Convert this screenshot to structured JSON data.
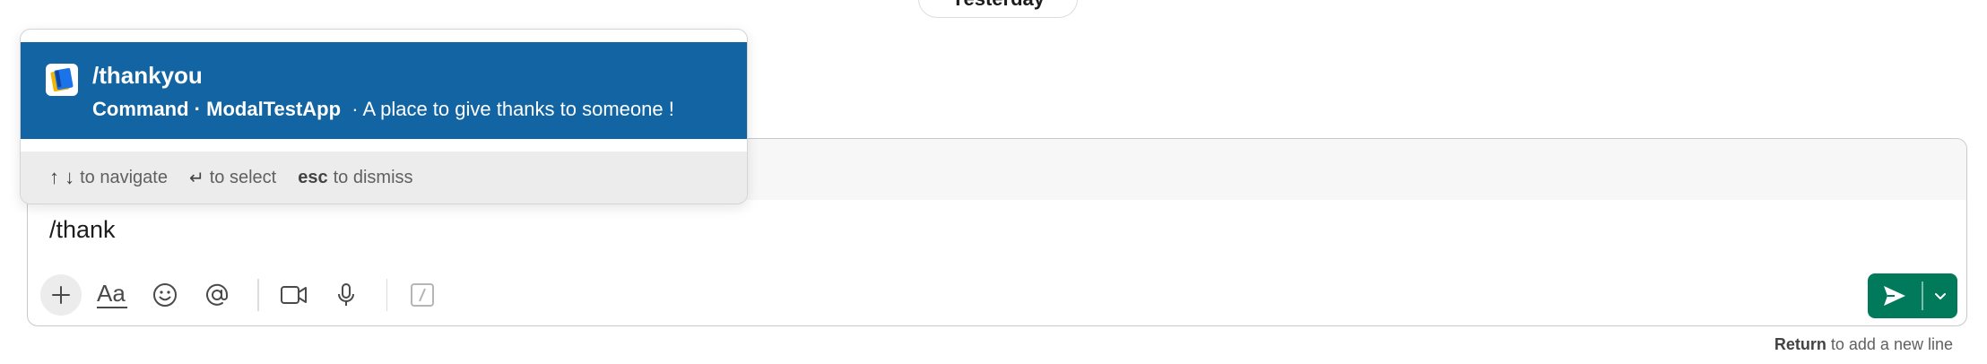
{
  "day_divider": {
    "label": "Yesterday"
  },
  "autocomplete": {
    "item": {
      "icon": "book-app-icon",
      "name": "/thankyou",
      "type_label": "Command",
      "app_name": "ModalTestApp",
      "description": "A place to give thanks to someone !"
    },
    "footer": {
      "navigate_keys": "↑ ↓",
      "navigate_text": "to navigate",
      "select_key": "↵",
      "select_text": "to select",
      "dismiss_key": "esc",
      "dismiss_text": "to dismiss"
    }
  },
  "composer": {
    "text": "/thank",
    "toolbar_icons": [
      "plus-icon",
      "text-format-icon",
      "emoji-icon",
      "mention-icon",
      "video-icon",
      "microphone-icon",
      "slash-command-icon"
    ],
    "send_icon": "send-icon",
    "send_menu_icon": "chevron-down-icon",
    "hint_key": "Return",
    "hint_text": "to add a new line"
  },
  "colors": {
    "highlight": "#1264a3",
    "send_button": "#007a5a"
  }
}
